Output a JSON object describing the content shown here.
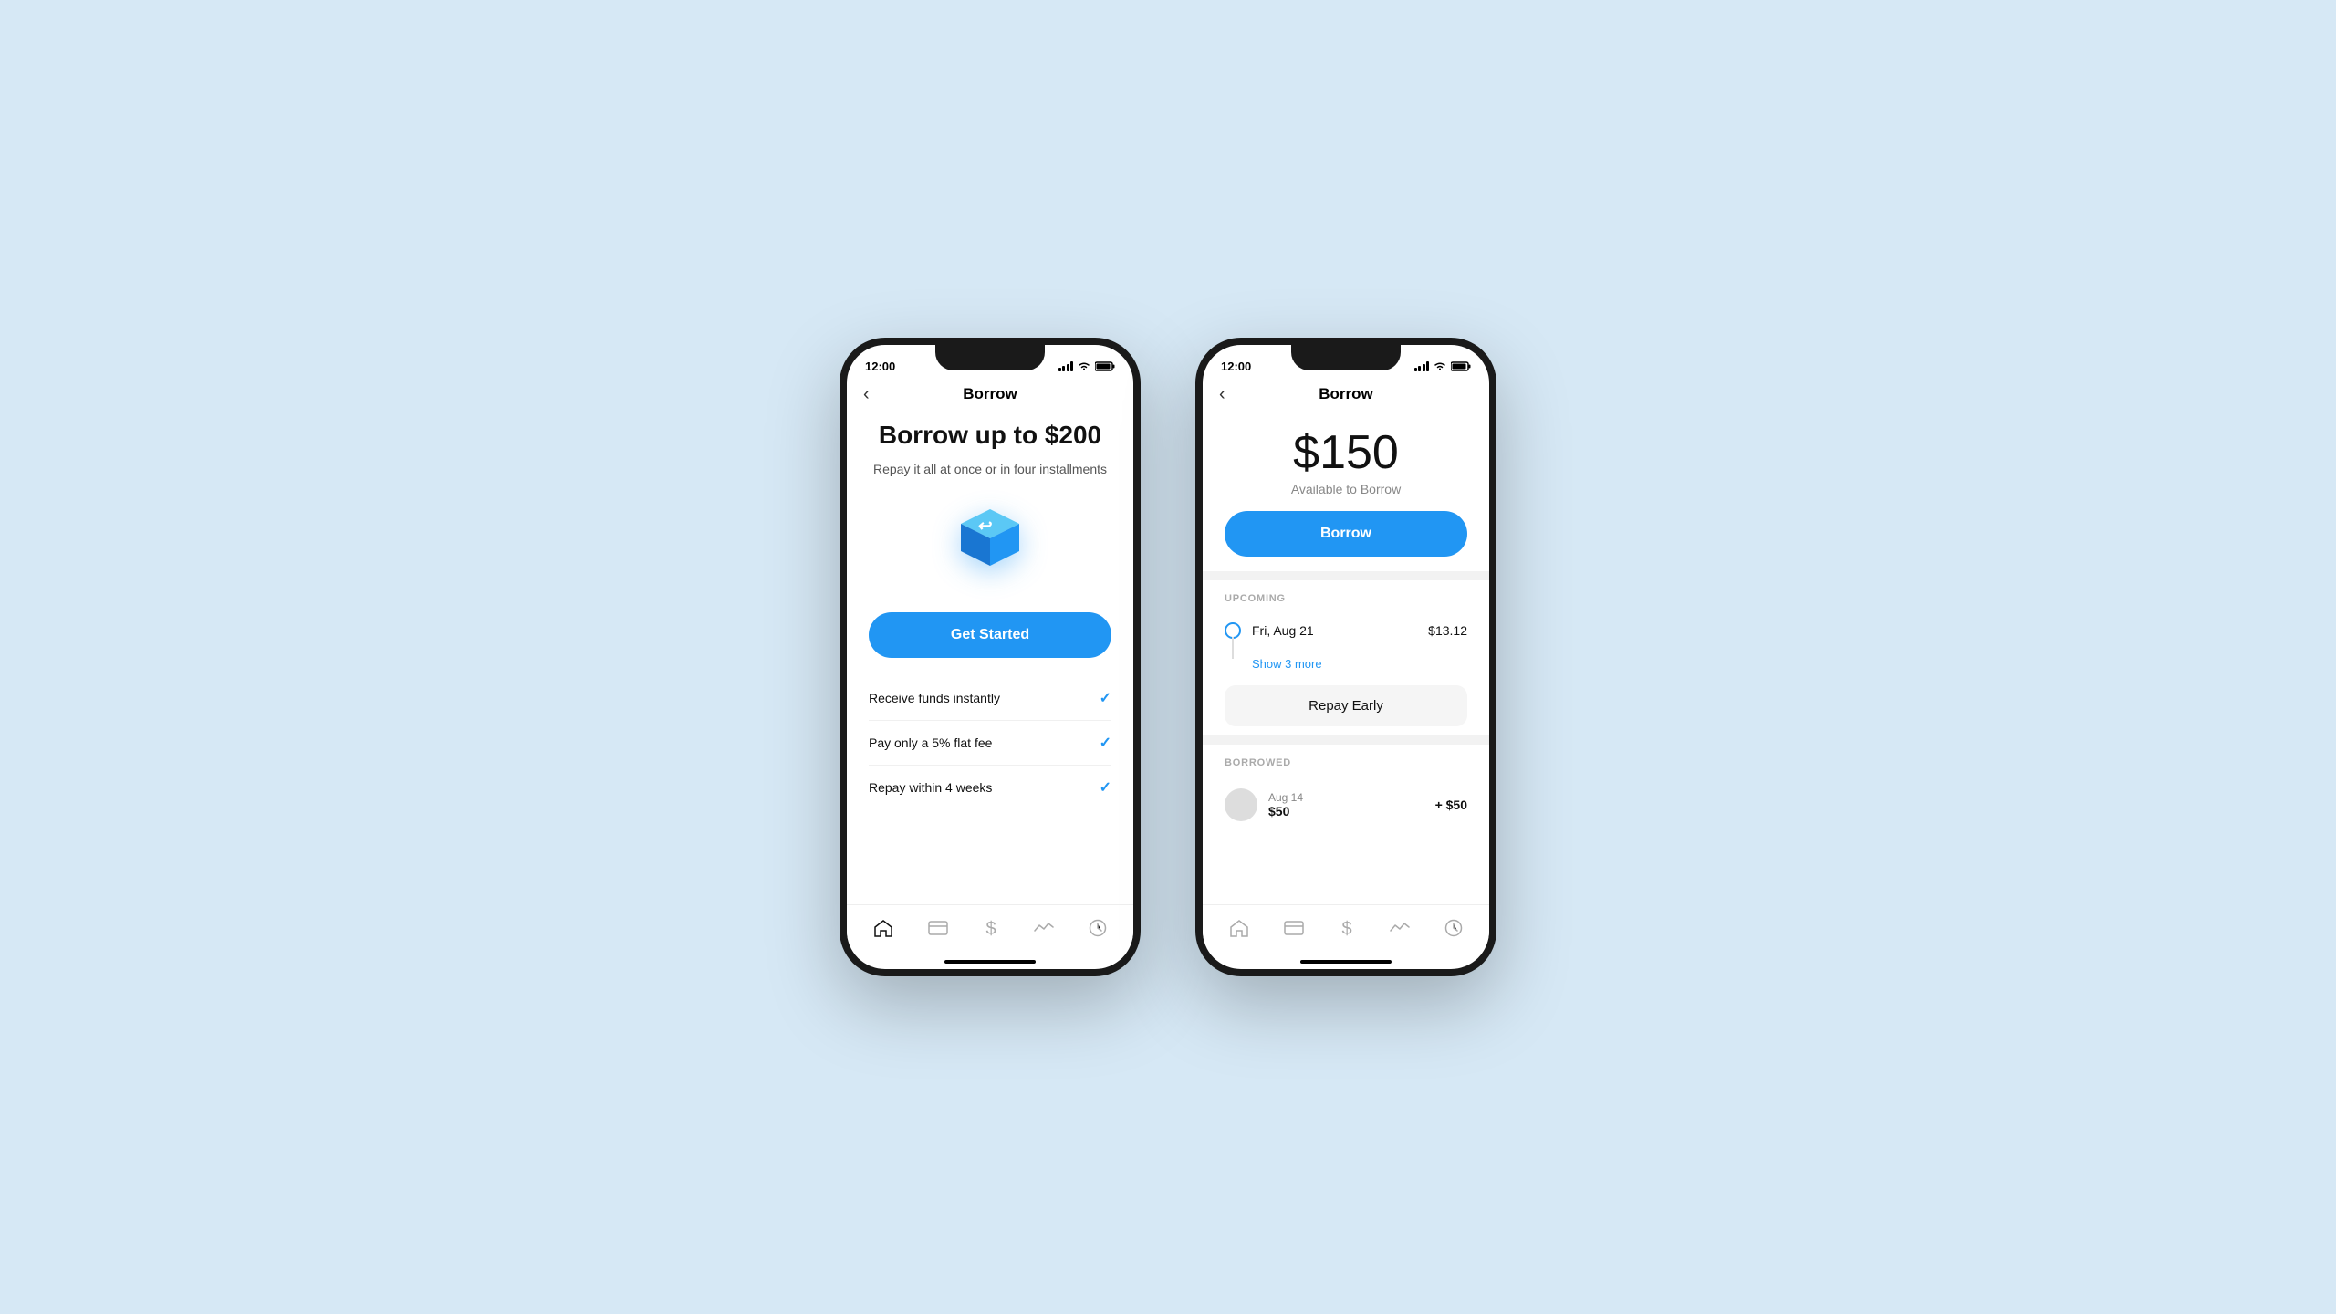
{
  "background": "#d6e8f5",
  "phone1": {
    "status": {
      "time": "12:00",
      "signal": true,
      "wifi": true,
      "battery": true
    },
    "nav": {
      "back_icon": "‹",
      "title": "Borrow"
    },
    "hero": {
      "title": "Borrow up to $200",
      "subtitle": "Repay it all at once or in four installments"
    },
    "cta": "Get Started",
    "features": [
      {
        "label": "Receive funds instantly",
        "check": "✓"
      },
      {
        "label": "Pay only a 5% flat fee",
        "check": "✓"
      },
      {
        "label": "Repay within 4 weeks",
        "check": "✓"
      }
    ],
    "tabs": [
      {
        "icon": "⊞",
        "label": "home",
        "active": true
      },
      {
        "icon": "▣",
        "label": "card"
      },
      {
        "icon": "$",
        "label": "money"
      },
      {
        "icon": "∿",
        "label": "activity"
      },
      {
        "icon": "◷",
        "label": "history"
      }
    ]
  },
  "phone2": {
    "status": {
      "time": "12:00"
    },
    "nav": {
      "back_icon": "‹",
      "title": "Borrow"
    },
    "amount": {
      "value": "$150",
      "label": "Available to Borrow"
    },
    "borrow_button": "Borrow",
    "upcoming": {
      "section_label": "UPCOMING",
      "items": [
        {
          "date": "Fri, Aug 21",
          "amount": "$13.12"
        }
      ],
      "show_more": "Show 3 more"
    },
    "repay_early": "Repay Early",
    "borrowed": {
      "section_label": "BORROWED",
      "items": [
        {
          "date": "Aug 14",
          "name": "$50",
          "amount": "+ $50"
        }
      ]
    },
    "tabs": [
      {
        "icon": "⊞",
        "label": "home"
      },
      {
        "icon": "▣",
        "label": "card"
      },
      {
        "icon": "$",
        "label": "money"
      },
      {
        "icon": "∿",
        "label": "activity"
      },
      {
        "icon": "◷",
        "label": "history"
      }
    ]
  }
}
